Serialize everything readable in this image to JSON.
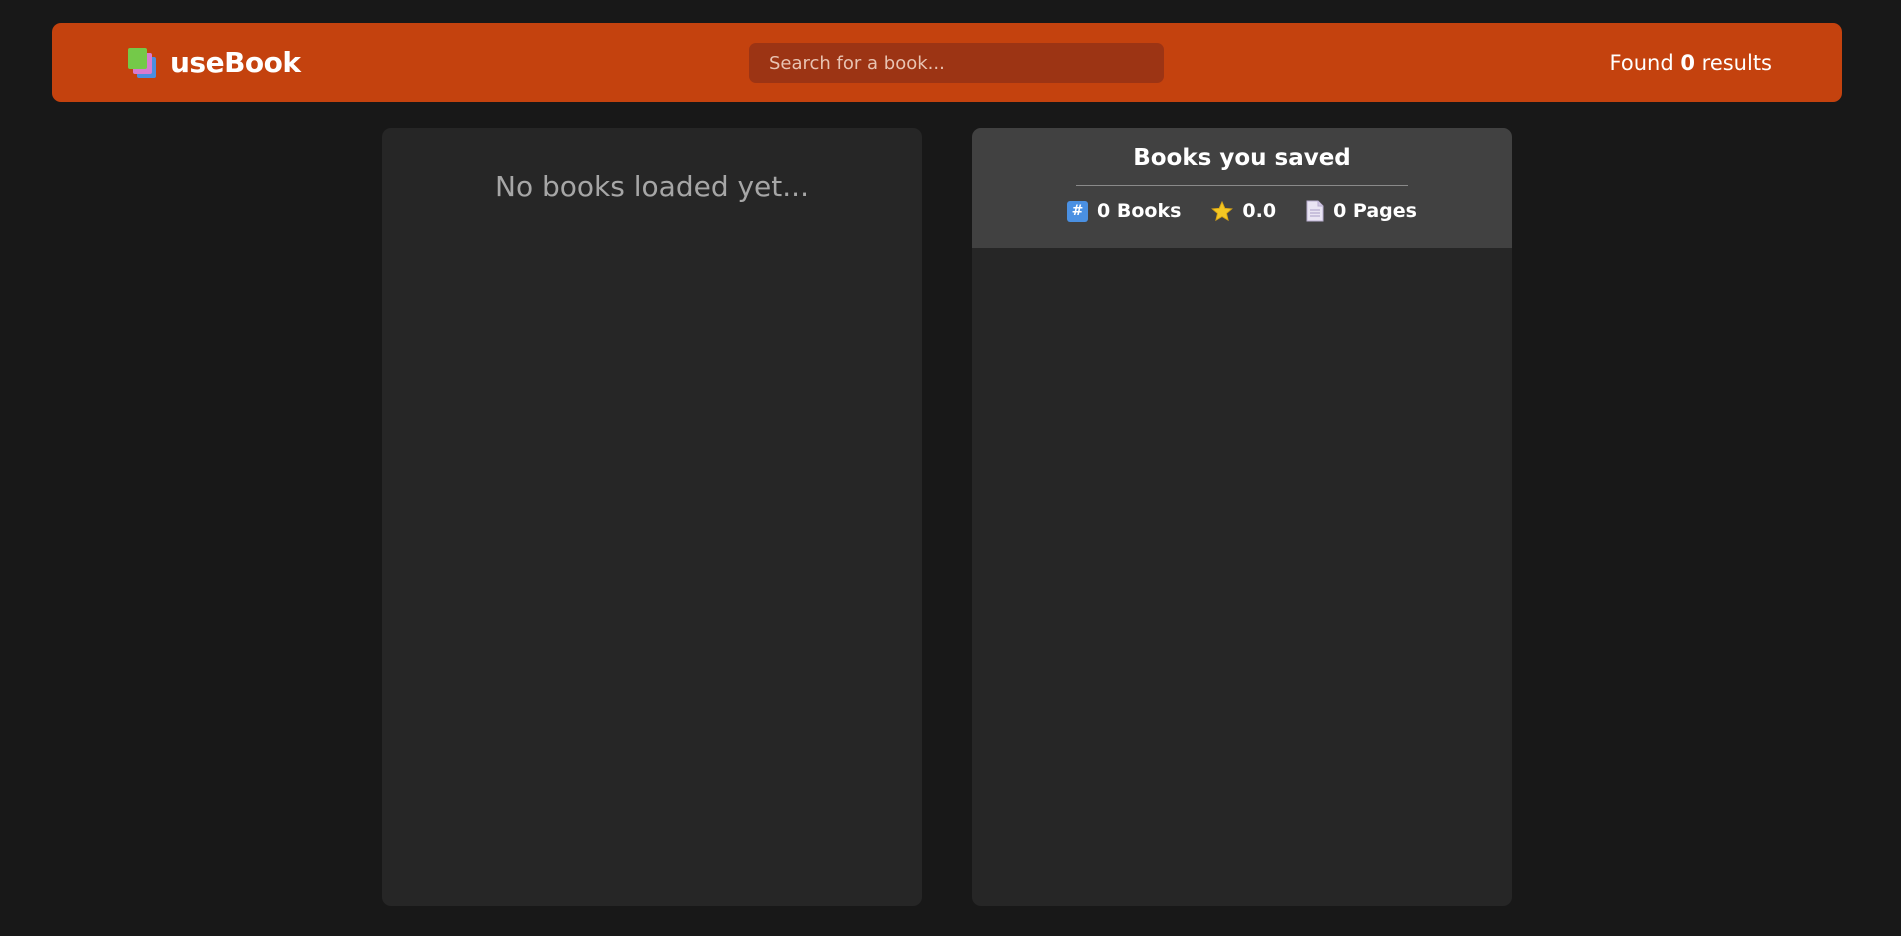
{
  "header": {
    "app_name": "useBook",
    "search_placeholder": "Search for a book...",
    "results_prefix": "Found ",
    "results_count": "0",
    "results_suffix": " results",
    "brand_color": "#c4420e"
  },
  "list_panel": {
    "empty_message": "No books loaded yet..."
  },
  "saved_panel": {
    "title": "Books you saved",
    "stats": [
      {
        "icon": "hash-icon",
        "label": "0 Books"
      },
      {
        "icon": "star-icon",
        "label": "0.0"
      },
      {
        "icon": "page-icon",
        "label": "0 Pages"
      }
    ]
  }
}
